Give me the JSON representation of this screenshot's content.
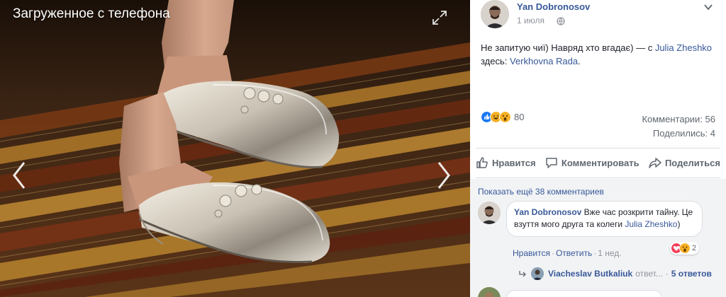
{
  "photo": {
    "album_title": "Загруженное с телефона"
  },
  "post": {
    "author": "Yan Dobronosov",
    "date": "1 июля",
    "text_main": "Не запитую чиї) Навряд хто вгадає) — с ",
    "tagged_person": "Julia Zheshko",
    "place_prefix": " здесь: ",
    "place": "Verkhovna Rada",
    "place_suffix": ".",
    "reactions_count": "80",
    "comments_label": "Комментарии: 56",
    "shares_label": "Поделились: 4"
  },
  "actions": {
    "like": "Нравится",
    "comment": "Комментировать",
    "share": "Поделиться"
  },
  "comments": {
    "show_more": "Показать ещё 38 комментариев",
    "first": {
      "author": "Yan Dobronosov",
      "text": " Вже час розкрити тайну. Це взуття мого друга та колеги ",
      "mention": "Julia Zheshko",
      "text_end": ")",
      "reactions_count": "2",
      "like_label": "Нравится",
      "reply_label": "Ответить",
      "time": "1 нед."
    },
    "replies": {
      "author": "Viacheslav Butkaliuk",
      "suffix": "ответ...",
      "count": "5 ответов"
    }
  },
  "colors": {
    "link": "#365899",
    "like_blue": "#1877f2",
    "love_red": "#f33e58",
    "haha_yellow": "#f7b125"
  }
}
